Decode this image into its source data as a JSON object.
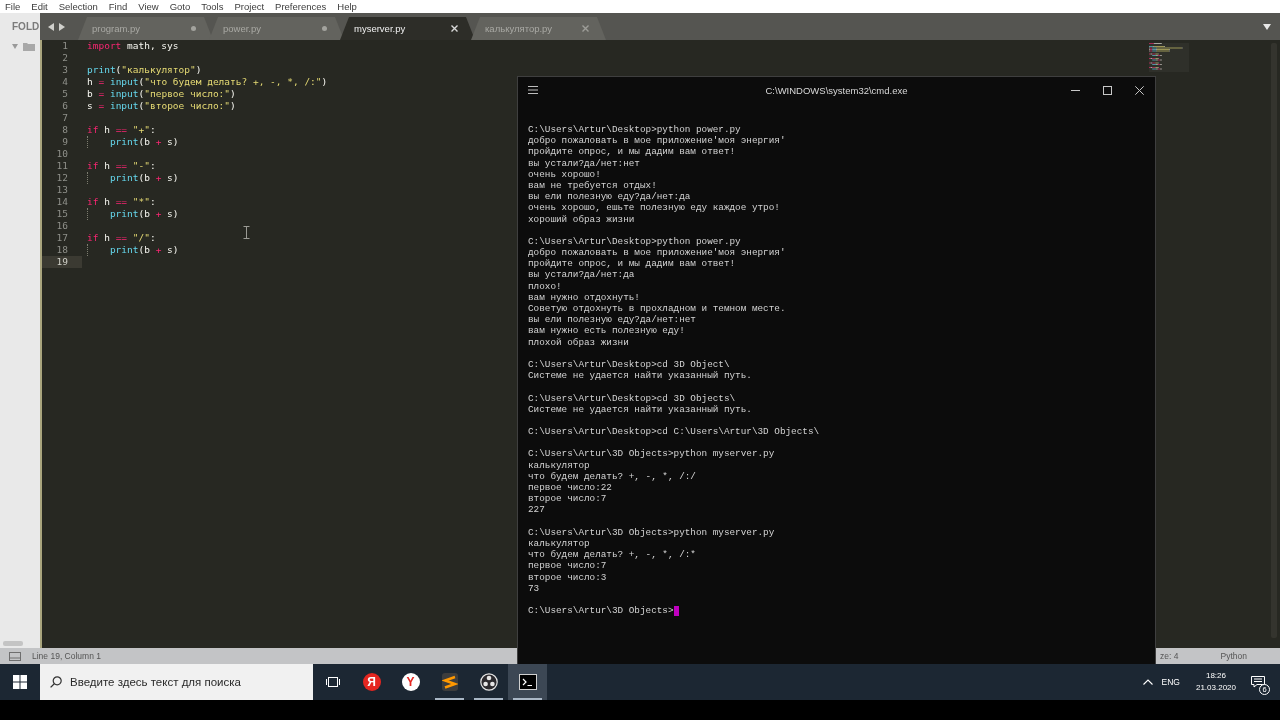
{
  "menu": [
    "File",
    "Edit",
    "Selection",
    "Find",
    "View",
    "Goto",
    "Tools",
    "Project",
    "Preferences",
    "Help"
  ],
  "sidebar": {
    "header": "FOLD",
    "folder": {
      "expanded": true
    }
  },
  "tabs": [
    {
      "label": "program.py",
      "selected": false,
      "modified": true
    },
    {
      "label": "power.py",
      "selected": false,
      "modified": true
    },
    {
      "label": "myserver.py",
      "selected": true,
      "modified": false
    },
    {
      "label": "калькулятор.py",
      "selected": false,
      "modified": false
    }
  ],
  "editor": {
    "lines": [
      {
        "number": "1",
        "current": false,
        "indented": false,
        "tokens": [
          {
            "kind": "keyword",
            "text": "import"
          },
          {
            "kind": "plain",
            "text": " math, sys"
          }
        ]
      },
      {
        "number": "2",
        "current": false,
        "indented": false
      },
      {
        "number": "3",
        "current": false,
        "indented": false,
        "tokens": [
          {
            "kind": "builtin",
            "text": "print"
          },
          {
            "kind": "plain",
            "text": "("
          },
          {
            "kind": "string",
            "text": "\"калькулятор\""
          },
          {
            "kind": "plain",
            "text": ")"
          }
        ]
      },
      {
        "number": "4",
        "current": false,
        "indented": false,
        "tokens": [
          {
            "kind": "plain",
            "text": "h"
          },
          {
            "kind": "operator",
            "text": " = "
          },
          {
            "kind": "builtin",
            "text": "input"
          },
          {
            "kind": "plain",
            "text": "("
          },
          {
            "kind": "string",
            "text": "\"что будем делать? +, -, *, /:\""
          },
          {
            "kind": "plain",
            "text": ")"
          }
        ]
      },
      {
        "number": "5",
        "current": false,
        "indented": false,
        "tokens": [
          {
            "kind": "plain",
            "text": "b"
          },
          {
            "kind": "operator",
            "text": " = "
          },
          {
            "kind": "builtin",
            "text": "input"
          },
          {
            "kind": "plain",
            "text": "("
          },
          {
            "kind": "string",
            "text": "\"первое число:\""
          },
          {
            "kind": "plain",
            "text": ")"
          }
        ]
      },
      {
        "number": "6",
        "current": false,
        "indented": false,
        "tokens": [
          {
            "kind": "plain",
            "text": "s"
          },
          {
            "kind": "operator",
            "text": " = "
          },
          {
            "kind": "builtin",
            "text": "input"
          },
          {
            "kind": "plain",
            "text": "("
          },
          {
            "kind": "string",
            "text": "\"второе число:\""
          },
          {
            "kind": "plain",
            "text": ")"
          }
        ]
      },
      {
        "number": "7",
        "current": false,
        "indented": false
      },
      {
        "number": "8",
        "current": false,
        "indented": false,
        "tokens": [
          {
            "kind": "keyword",
            "text": "if"
          },
          {
            "kind": "plain",
            "text": " h"
          },
          {
            "kind": "operator",
            "text": " == "
          },
          {
            "kind": "string",
            "text": "\"+\""
          },
          {
            "kind": "plain",
            "text": ":"
          }
        ]
      },
      {
        "number": "9",
        "current": false,
        "indented": true,
        "tokens": [
          {
            "kind": "builtin",
            "text": "print"
          },
          {
            "kind": "plain",
            "text": "(b"
          },
          {
            "kind": "operator",
            "text": " + "
          },
          {
            "kind": "plain",
            "text": "s)"
          }
        ]
      },
      {
        "number": "10",
        "current": false,
        "indented": false
      },
      {
        "number": "11",
        "current": false,
        "indented": false,
        "tokens": [
          {
            "kind": "keyword",
            "text": "if"
          },
          {
            "kind": "plain",
            "text": " h"
          },
          {
            "kind": "operator",
            "text": " == "
          },
          {
            "kind": "string",
            "text": "\"-\""
          },
          {
            "kind": "plain",
            "text": ":"
          }
        ]
      },
      {
        "number": "12",
        "current": false,
        "indented": true,
        "tokens": [
          {
            "kind": "builtin",
            "text": "print"
          },
          {
            "kind": "plain",
            "text": "(b"
          },
          {
            "kind": "operator",
            "text": " + "
          },
          {
            "kind": "plain",
            "text": "s)"
          }
        ]
      },
      {
        "number": "13",
        "current": false,
        "indented": false
      },
      {
        "number": "14",
        "current": false,
        "indented": false,
        "tokens": [
          {
            "kind": "keyword",
            "text": "if"
          },
          {
            "kind": "plain",
            "text": " h"
          },
          {
            "kind": "operator",
            "text": " == "
          },
          {
            "kind": "string",
            "text": "\"*\""
          },
          {
            "kind": "plain",
            "text": ":"
          }
        ]
      },
      {
        "number": "15",
        "current": false,
        "indented": true,
        "tokens": [
          {
            "kind": "builtin",
            "text": "print"
          },
          {
            "kind": "plain",
            "text": "(b"
          },
          {
            "kind": "operator",
            "text": " + "
          },
          {
            "kind": "plain",
            "text": "s)"
          }
        ]
      },
      {
        "number": "16",
        "current": false,
        "indented": false
      },
      {
        "number": "17",
        "current": false,
        "indented": false,
        "tokens": [
          {
            "kind": "keyword",
            "text": "if"
          },
          {
            "kind": "plain",
            "text": " h"
          },
          {
            "kind": "operator",
            "text": " == "
          },
          {
            "kind": "string",
            "text": "\"/\""
          },
          {
            "kind": "plain",
            "text": ":"
          }
        ]
      },
      {
        "number": "18",
        "current": false,
        "indented": true,
        "tokens": [
          {
            "kind": "builtin",
            "text": "print"
          },
          {
            "kind": "plain",
            "text": "(b"
          },
          {
            "kind": "operator",
            "text": " + "
          },
          {
            "kind": "plain",
            "text": "s)"
          }
        ]
      },
      {
        "number": "19",
        "current": true,
        "indented": false
      }
    ]
  },
  "status_bar": {
    "position": "Line 19, Column 1",
    "tab_size": "ze: 4",
    "syntax": "Python"
  },
  "console": {
    "title": "C:\\WINDOWS\\system32\\cmd.exe",
    "blocks": [
      [
        "C:\\Users\\Artur\\Desktop>python power.py",
        "добро пожаловать в мое приложение'моя энергия'",
        "пройдите опрос, и мы дадим вам ответ!",
        "вы устали?да/нет:нет",
        "очень хорошо!",
        "вам не требуется отдых!",
        "вы ели полезную еду?да/нет:да",
        "очень хорошо, ешьте полезную еду каждое утро!",
        "хороший образ жизни"
      ],
      [
        "C:\\Users\\Artur\\Desktop>python power.py",
        "добро пожаловать в мое приложение'моя энергия'",
        "пройдите опрос, и мы дадим вам ответ!",
        "вы устали?да/нет:да",
        "плохо!",
        "вам нужно отдохнуть!",
        "Советую отдохнуть в прохладном и темном месте.",
        "вы ели полезную еду?да/нет:нет",
        "вам нужно есть полезную еду!",
        "плохой образ жизни"
      ],
      [
        "C:\\Users\\Artur\\Desktop>cd 3D Object\\",
        "Системе не удается найти указанный путь."
      ],
      [
        "C:\\Users\\Artur\\Desktop>cd 3D Objects\\",
        "Системе не удается найти указанный путь."
      ],
      [
        "C:\\Users\\Artur\\Desktop>cd C:\\Users\\Artur\\3D Objects\\"
      ],
      [
        "C:\\Users\\Artur\\3D Objects>python myserver.py",
        "калькулятор",
        "что будем делать? +, -, *, /:/",
        "первое число:22",
        "второе число:7",
        "227"
      ],
      [
        "C:\\Users\\Artur\\3D Objects>python myserver.py",
        "калькулятор",
        "что будем делать? +, -, *, /:*",
        "первое число:7",
        "второе число:3",
        "73"
      ]
    ],
    "prompt": "C:\\Users\\Artur\\3D Objects>"
  },
  "taskbar": {
    "search": {
      "placeholder": "Введите здесь текст для поиска"
    },
    "apps": [
      {
        "kind": "yandex-browser",
        "glyph": "Я",
        "running": false,
        "selected": false
      },
      {
        "kind": "yandex",
        "glyph": "Y",
        "running": false,
        "selected": false
      },
      {
        "kind": "sublime",
        "running": true,
        "selected": false
      },
      {
        "kind": "obs",
        "running": true,
        "selected": false
      },
      {
        "kind": "terminal",
        "running": true,
        "selected": true
      }
    ],
    "language": "ENG",
    "time": "18:26",
    "date": "21.03.2020",
    "notifications": "6"
  }
}
